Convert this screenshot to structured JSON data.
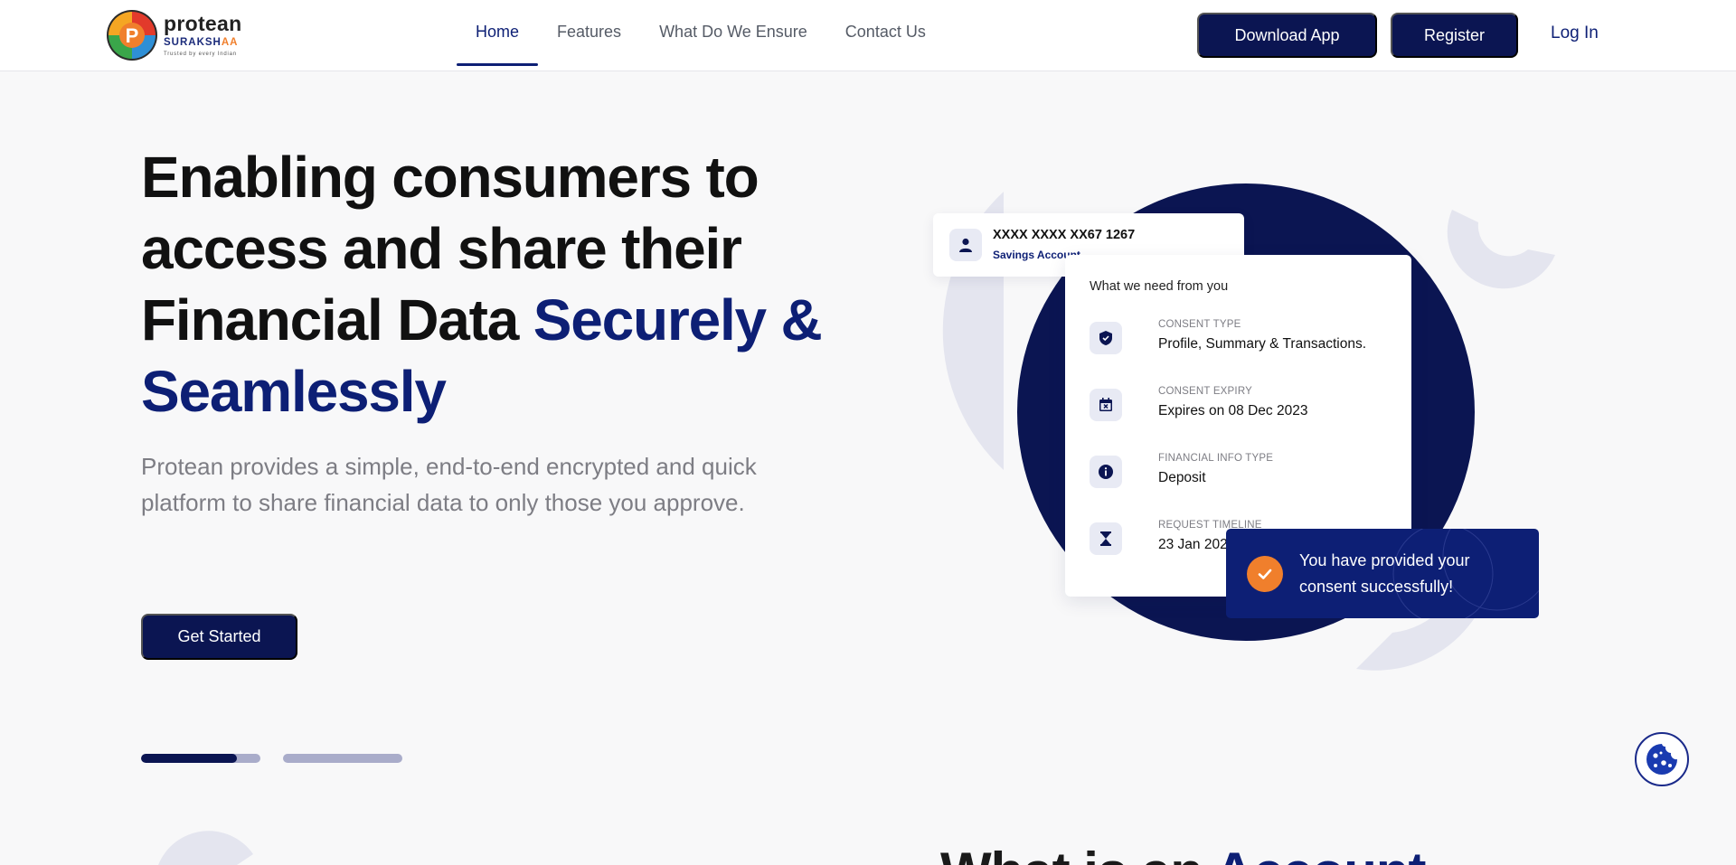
{
  "brand": {
    "name": "protean",
    "sub_main": "SURAKSH",
    "sub_accent": "AA",
    "tagline": "Trusted by every Indian",
    "colors": {
      "primary": "#0b1552",
      "accent": "#0d1f75",
      "orange": "#f07f2c"
    }
  },
  "nav": {
    "items": [
      {
        "label": "Home",
        "active": true
      },
      {
        "label": "Features",
        "active": false
      },
      {
        "label": "What Do We Ensure",
        "active": false
      },
      {
        "label": "Contact Us",
        "active": false
      }
    ],
    "download_label": "Download App",
    "register_label": "Register",
    "login_label": "Log In"
  },
  "hero": {
    "title_plain": "Enabling consumers to access and share their Financial Data ",
    "title_accent": "Securely & Seamlessly",
    "description": "Protean provides a simple, end-to-end encrypted and quick platform to share financial data to only those you approve.",
    "cta_label": "Get Started",
    "slides": [
      {
        "progress": 0.8
      },
      {
        "progress": 0
      }
    ]
  },
  "illustration": {
    "account": {
      "number": "XXXX XXXX XX67 1267",
      "type": "Savings Account",
      "icon": "user-icon"
    },
    "consent": {
      "heading": "What we need from you",
      "rows": [
        {
          "label": "CONSENT TYPE",
          "value": "Profile, Summary & Transactions.",
          "icon": "shield-icon"
        },
        {
          "label": "CONSENT EXPIRY",
          "value": "Expires on 08 Dec 2023",
          "icon": "calendar-icon"
        },
        {
          "label": "FINANCIAL INFO TYPE",
          "value": "Deposit",
          "icon": "info-icon"
        },
        {
          "label": "REQUEST TIMELINE",
          "value": "23 Jan 2023 - 0",
          "icon": "hourglass-icon"
        }
      ]
    },
    "toast": {
      "message": "You have provided your consent successfully!",
      "icon": "check-icon"
    }
  },
  "next_section": {
    "title_plain": "What is an ",
    "title_accent": "Account"
  },
  "cookie": {
    "icon": "cookie-icon"
  }
}
